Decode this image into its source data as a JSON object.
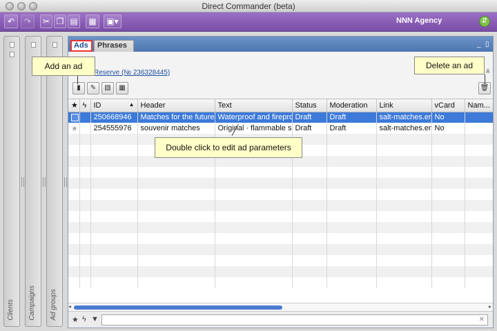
{
  "window": {
    "title": "Direct Commander (beta)"
  },
  "toolbar": {
    "agency": "NNN Agency"
  },
  "sidebar": {
    "panels": [
      {
        "label": "Clients"
      },
      {
        "label": "Campaigns"
      },
      {
        "label": "Ad groups"
      }
    ]
  },
  "tabs": [
    {
      "label": "Ads",
      "active": true
    },
    {
      "label": "Phrases",
      "active": false
    }
  ],
  "campaign": {
    "link": "Reserve (№ 236328445)"
  },
  "table": {
    "columns": [
      "ID",
      "Header",
      "Text",
      "Status",
      "Moderation",
      "Link",
      "vCard",
      "Nam..."
    ],
    "rows": [
      {
        "id": "250668946",
        "header": "Matches for the future",
        "text": "Waterproof and fireproc",
        "status": "Draft",
        "moderation": "Draft",
        "link": "salt-matches.en",
        "vcard": "No"
      },
      {
        "id": "254555976",
        "header": "souvenir matches",
        "text": "Original · flammable sou",
        "status": "Draft",
        "moderation": "Draft",
        "link": "salt-matches.en",
        "vcard": "No"
      }
    ]
  },
  "callouts": {
    "add": "Add an ad",
    "delete": "Delete an ad",
    "edit": "Double click to edit ad parameters"
  },
  "colors": {
    "toolbar": "#8a5fb5",
    "tabstrip": "#5a82bb",
    "selection": "#3d7ad9",
    "callout": "#ffffc8"
  }
}
